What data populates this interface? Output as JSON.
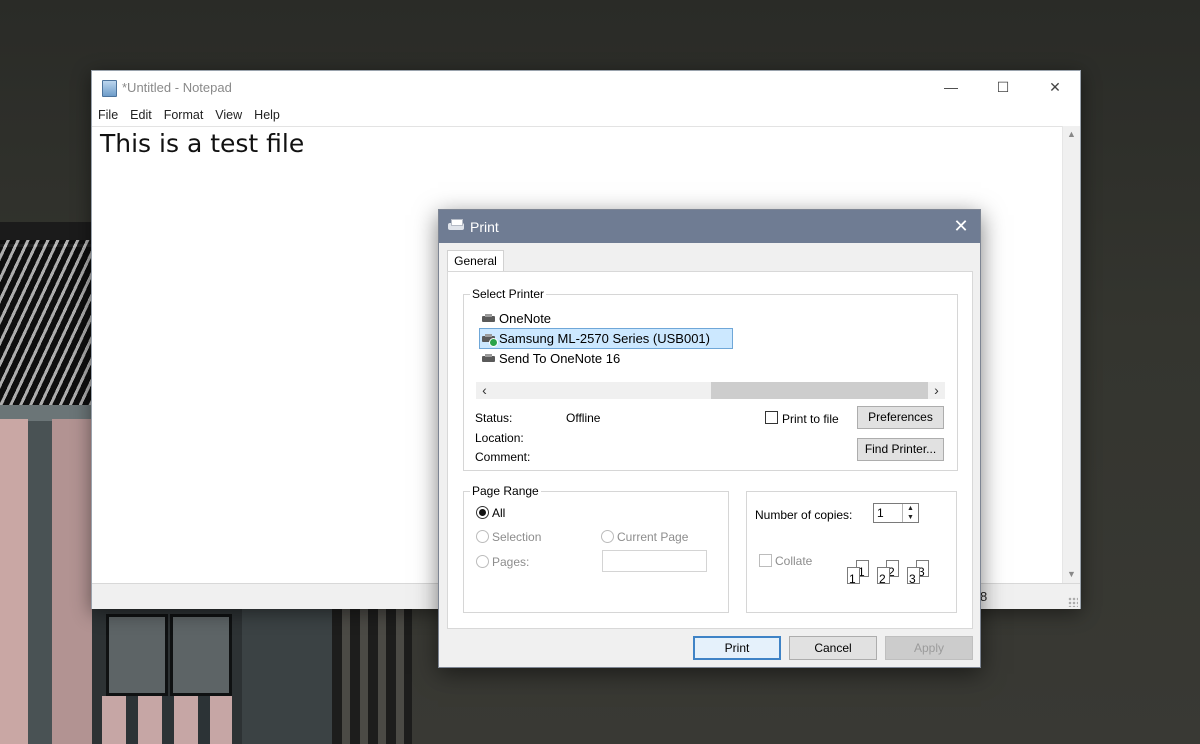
{
  "notepad": {
    "title": "*Untitled - Notepad",
    "controls": {
      "minimize": "—",
      "maximize": "☐",
      "close": "✕"
    },
    "menu": [
      "File",
      "Edit",
      "Format",
      "View",
      "Help"
    ],
    "content": "This is a test file",
    "status_fragment": "8"
  },
  "print_dialog": {
    "title": "Print",
    "close": "✕",
    "tab": "General",
    "select_printer": {
      "legend": "Select Printer",
      "printers": [
        {
          "name": "OneNote",
          "selected": false
        },
        {
          "name": "Samsung ML-2570 Series (USB001)",
          "selected": true
        },
        {
          "name": "Send To OneNote 16",
          "selected": false
        }
      ],
      "status_label": "Status:",
      "status_value": "Offline",
      "location_label": "Location:",
      "comment_label": "Comment:",
      "print_to_file": "Print to file",
      "preferences": "Preferences",
      "find_printer": "Find Printer..."
    },
    "page_range": {
      "legend": "Page Range",
      "all": "All",
      "selection": "Selection",
      "current_page": "Current Page",
      "pages": "Pages:"
    },
    "copies": {
      "label": "Number of copies:",
      "value": "1",
      "collate": "Collate",
      "sheets": [
        "1",
        "1",
        "2",
        "2",
        "3",
        "3"
      ]
    },
    "buttons": {
      "print": "Print",
      "cancel": "Cancel",
      "apply": "Apply"
    }
  }
}
